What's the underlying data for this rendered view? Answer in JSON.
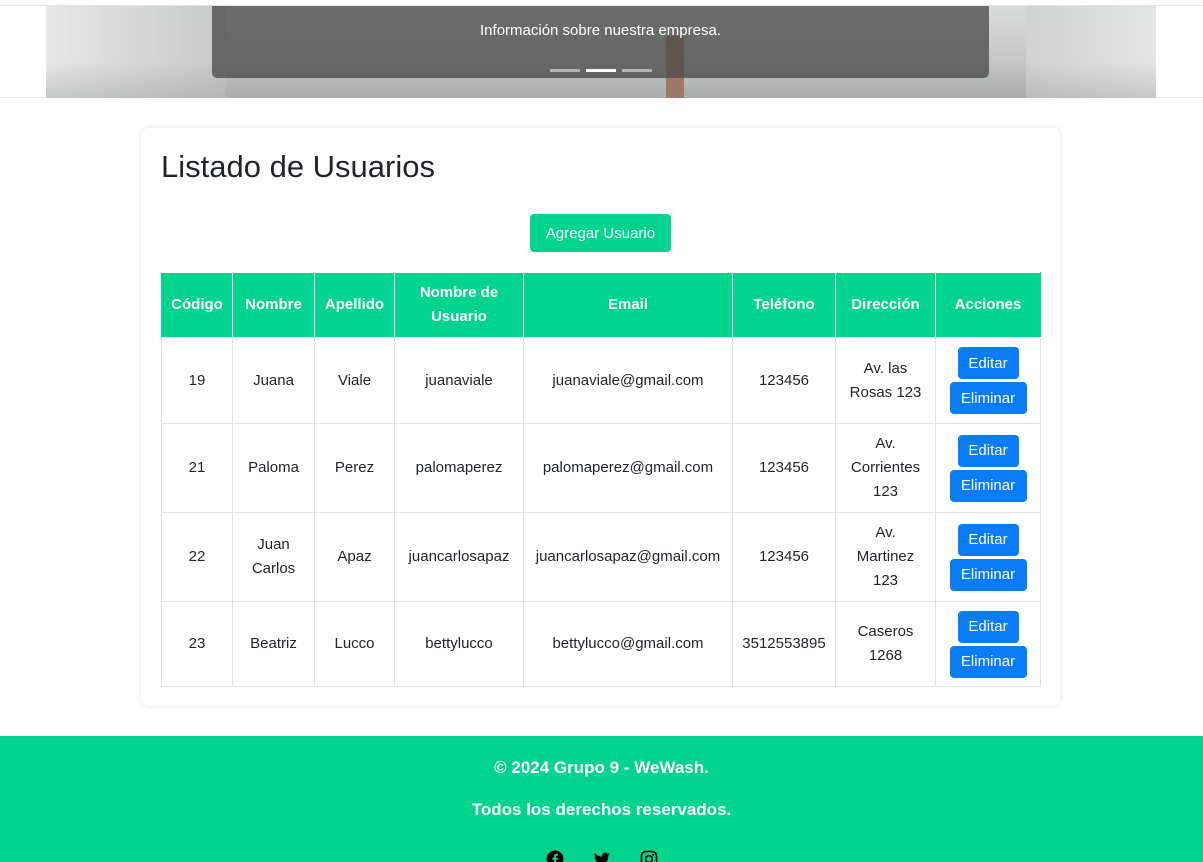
{
  "carousel": {
    "caption": "Información sobre nuestra empresa.",
    "indicators": 3,
    "active_index": 2
  },
  "page": {
    "title": "Listado de Usuarios",
    "add_button": "Agregar Usuario"
  },
  "table": {
    "headers": [
      "Código",
      "Nombre",
      "Apellido",
      "Nombre de Usuario",
      "Email",
      "Teléfono",
      "Dirección",
      "Acciones"
    ],
    "rows": [
      {
        "codigo": "19",
        "nombre": "Juana",
        "apellido": "Viale",
        "usuario": "juanaviale",
        "email": "juanaviale@gmail.com",
        "telefono": "123456",
        "direccion": "Av. las Rosas 123"
      },
      {
        "codigo": "21",
        "nombre": "Paloma",
        "apellido": "Perez",
        "usuario": "palomaperez",
        "email": "palomaperez@gmail.com",
        "telefono": "123456",
        "direccion": "Av. Corrientes 123"
      },
      {
        "codigo": "22",
        "nombre": "Juan Carlos",
        "apellido": "Apaz",
        "usuario": "juancarlosapaz",
        "email": "juancarlosapaz@gmail.com",
        "telefono": "123456",
        "direccion": "Av. Martinez 123"
      },
      {
        "codigo": "23",
        "nombre": "Beatriz",
        "apellido": "Lucco",
        "usuario": "bettylucco",
        "email": "bettylucco@gmail.com",
        "telefono": "3512553895",
        "direccion": "Caseros 1268"
      }
    ],
    "edit_label": "Editar",
    "delete_label": "Eliminar"
  },
  "footer": {
    "copyright": "© 2024 Grupo 9 - WeWash.",
    "rights": "Todos los derechos reservados.",
    "social_icons": [
      "facebook-icon",
      "twitter-icon",
      "instagram-icon"
    ]
  },
  "colors": {
    "brand": "#02d38f",
    "button_primary": "#0a7cf7",
    "caption_bg": "#4b4b4b"
  }
}
